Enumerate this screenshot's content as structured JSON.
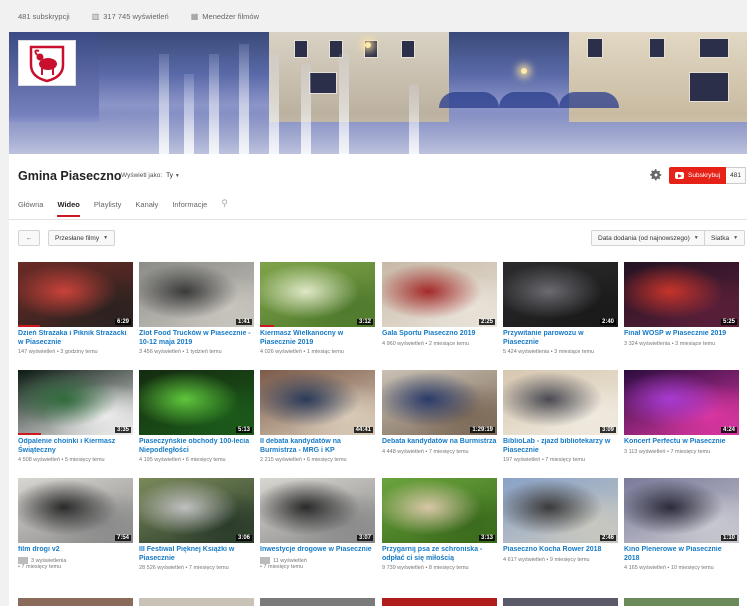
{
  "stats": {
    "subscriptions": "481 subskrypcji",
    "views": "317 745 wyświetleń",
    "video_manager": "Menedżer filmów"
  },
  "channel": {
    "name": "Gmina Piaseczno",
    "view_as_label": "Wyświetl jako:",
    "view_as_value": "Ty",
    "subscribe_label": "Subskrybuj",
    "subscriber_count": "481"
  },
  "tabs": [
    "Główna",
    "Wideo",
    "Playlisty",
    "Kanały",
    "Informacje"
  ],
  "toolbar": {
    "uploaded": "Przesłane filmy",
    "sort": "Data dodania (od najnowszego)",
    "view": "Siatka"
  },
  "videos": [
    {
      "title": "Dzień Strażaka i Piknik Strażacki w Piasecznie",
      "meta": "147 wyświetleń • 3 godziny temu",
      "duration": "6:29"
    },
    {
      "title": "Zlot Food Trucków w Piasecznie - 10-12 maja 2019",
      "meta": "3 456 wyświetleń • 1 tydzień temu",
      "duration": "1:41"
    },
    {
      "title": "Kiermasz Wielkanocny w Piasecznie 2019",
      "meta": "4 026 wyświetleń • 1 miesiąc temu",
      "duration": "3:12"
    },
    {
      "title": "Gala Sportu Piaseczno 2019",
      "meta": "4 960 wyświetleń • 2 miesiące temu",
      "duration": "2:25"
    },
    {
      "title": "Przywitanie parowozu w Piasecznie",
      "meta": "5 424 wyświetlenia • 3 miesiące temu",
      "duration": "2:40"
    },
    {
      "title": "Finał WOŚP w Piasecznie 2019",
      "meta": "3 324 wyświetlenia • 3 miesiące temu",
      "duration": "5:25"
    },
    {
      "title": "Odpalenie choinki i Kiermasz Świąteczny",
      "meta": "4 508 wyświetleń • 5 miesięcy temu",
      "duration": "3:35"
    },
    {
      "title": "Piaseczyńskie obchody 100-lecia Niepodległości",
      "meta": "4 195 wyświetleń • 6 miesięcy temu",
      "duration": "5:13"
    },
    {
      "title": "II debata kandydatów na Burmistrza - MRG i KP",
      "meta": "2 215 wyświetleń • 6 miesięcy temu",
      "duration": "44:41"
    },
    {
      "title": "Debata kandydatów na Burmistrza",
      "meta": "4 448 wyświetleń • 7 miesięcy temu",
      "duration": "1:29:19"
    },
    {
      "title": "BiblioLab - zjazd bibliotekarzy w Piasecznie",
      "meta": "197 wyświetleń • 7 miesięcy temu",
      "duration": "3:09"
    },
    {
      "title": "Koncert Perfectu w Piasecznie",
      "meta": "3 113 wyświetleń • 7 miesięcy temu",
      "duration": "4:24"
    },
    {
      "title": "film drogi v2",
      "meta": "3 wyświetlenia",
      "meta2": "• 7 miesięcy temu",
      "duration": "7:54"
    },
    {
      "title": "III Festiwal Pięknej Książki w Piasecznie",
      "meta": "28 526 wyświetleń • 7 miesięcy temu",
      "duration": "3:06"
    },
    {
      "title": "Inwestycje drogowe w Piasecznie",
      "meta": "11 wyświetleń",
      "meta2": "• 7 miesięcy temu",
      "duration": "3:07"
    },
    {
      "title": "Przygarnij psa ze schroniska - odpłać ci się miłością",
      "meta": "9 739 wyświetleń • 8 miesięcy temu",
      "duration": "3:13"
    },
    {
      "title": "Piaseczno Kocha Rower 2018",
      "meta": "4 617 wyświetleń • 9 miesięcy temu",
      "duration": "2:46"
    },
    {
      "title": "Kino Plenerowe w Piasecznie 2018",
      "meta": "4 165 wyświetleń • 10 miesięcy temu",
      "duration": "1:10"
    }
  ],
  "thumb_colors": [
    [
      "#6b2b25",
      "#c9423a",
      "#2b2220"
    ],
    [
      "#8c8c88",
      "#3a3a3a",
      "#c8c5bd"
    ],
    [
      "#7fa34a",
      "#dfe8c7",
      "#4f7a2c"
    ],
    [
      "#c7b9a6",
      "#a32a2a",
      "#e8e2d8"
    ],
    [
      "#2b2b2d",
      "#6a6a70",
      "#1a1a1a"
    ],
    [
      "#241322",
      "#c7342a",
      "#5a1f39"
    ],
    [
      "#0c1a12",
      "#2f6b3c",
      "#eeeeee"
    ],
    [
      "#142b10",
      "#5fc63c",
      "#1c5a1a"
    ],
    [
      "#7b5a48",
      "#2a3a5a",
      "#d9cbb8"
    ],
    [
      "#c9c1b4",
      "#2a3b6a",
      "#7d6a58"
    ],
    [
      "#d6c7b0",
      "#4a4a52",
      "#f0eadf"
    ],
    [
      "#2b0d3f",
      "#a63bd1",
      "#d936a0"
    ],
    [
      "#d8d6d0",
      "#2a2a2a",
      "#8a8a8a"
    ],
    [
      "#7a8a5a",
      "#c0c0c0",
      "#2a3b2a"
    ],
    [
      "#d8d6d0",
      "#2a2a2a",
      "#8a8a8a"
    ],
    [
      "#6aa43c",
      "#d9c7a8",
      "#3a6a1c"
    ],
    [
      "#8aa2c8",
      "#3a3a3a",
      "#c8c8c0"
    ],
    [
      "#7a7a9a",
      "#2a2a3a",
      "#c8c8d0"
    ]
  ],
  "progress": [
    0.19,
    0,
    0.12,
    0,
    0,
    0,
    0.2,
    0,
    0,
    0,
    0,
    0,
    0,
    0,
    0,
    0,
    0,
    0
  ],
  "bottom_colors": [
    "#8a6a5a",
    "#c9c2b6",
    "#7a7a7a",
    "#b01c1c",
    "#5a5a6a",
    "#6a8a5a"
  ]
}
